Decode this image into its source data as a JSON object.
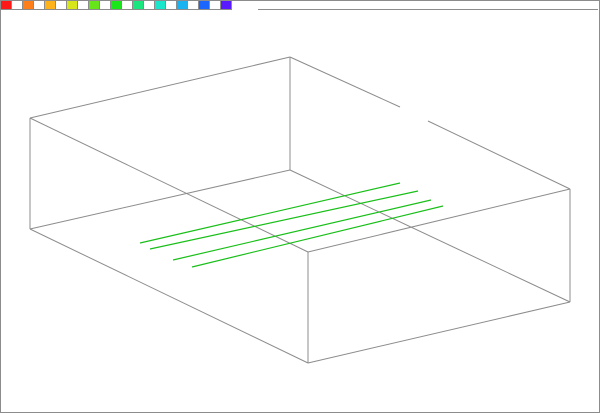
{
  "palette": {
    "swatches": [
      {
        "name": "red",
        "color": "#ff1a1a"
      },
      {
        "name": "blank",
        "color": ""
      },
      {
        "name": "orange",
        "color": "#ff7f1a"
      },
      {
        "name": "blank",
        "color": ""
      },
      {
        "name": "amber",
        "color": "#ffb31a"
      },
      {
        "name": "blank",
        "color": ""
      },
      {
        "name": "yellow",
        "color": "#d6e61a"
      },
      {
        "name": "blank",
        "color": ""
      },
      {
        "name": "lime",
        "color": "#66e61a"
      },
      {
        "name": "blank",
        "color": ""
      },
      {
        "name": "green",
        "color": "#1ae61a"
      },
      {
        "name": "blank",
        "color": ""
      },
      {
        "name": "spring-green",
        "color": "#1ae680"
      },
      {
        "name": "blank",
        "color": ""
      },
      {
        "name": "turquoise",
        "color": "#1ae6cc"
      },
      {
        "name": "blank",
        "color": ""
      },
      {
        "name": "sky",
        "color": "#1ab3f2"
      },
      {
        "name": "blank",
        "color": ""
      },
      {
        "name": "blue",
        "color": "#1a66ff"
      },
      {
        "name": "blank",
        "color": ""
      },
      {
        "name": "violet",
        "color": "#5a1aff"
      }
    ]
  },
  "scene": {
    "box_color": "#8c8c8c",
    "trace_color": "#1abf1a"
  }
}
